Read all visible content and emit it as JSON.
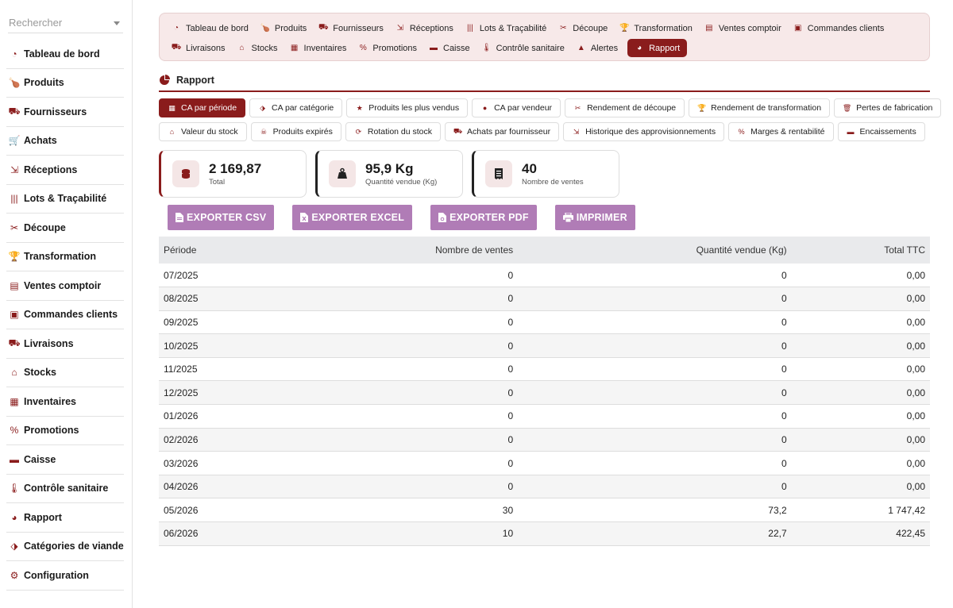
{
  "search": {
    "placeholder": "Rechercher"
  },
  "sidebar": {
    "items": [
      {
        "label": "Tableau de bord",
        "icon": "dashboard-icon"
      },
      {
        "label": "Produits",
        "icon": "drumstick-icon"
      },
      {
        "label": "Fournisseurs",
        "icon": "truck-icon"
      },
      {
        "label": "Achats",
        "icon": "cart-icon"
      },
      {
        "label": "Réceptions",
        "icon": "dolly-icon"
      },
      {
        "label": "Lots & Traçabilité",
        "icon": "barcode-icon"
      },
      {
        "label": "Découpe",
        "icon": "scissors-icon"
      },
      {
        "label": "Transformation",
        "icon": "trophy-icon"
      },
      {
        "label": "Ventes comptoir",
        "icon": "cash-register-icon"
      },
      {
        "label": "Commandes clients",
        "icon": "clipboard-icon"
      },
      {
        "label": "Livraisons",
        "icon": "truck-loading-icon"
      },
      {
        "label": "Stocks",
        "icon": "warehouse-icon"
      },
      {
        "label": "Inventaires",
        "icon": "boxes-icon"
      },
      {
        "label": "Promotions",
        "icon": "percent-icon"
      },
      {
        "label": "Caisse",
        "icon": "money-bill-icon"
      },
      {
        "label": "Contrôle sanitaire",
        "icon": "thermometer-icon"
      },
      {
        "label": "Rapport",
        "icon": "pie-chart-icon"
      },
      {
        "label": "Catégories de viande",
        "icon": "tags-icon"
      },
      {
        "label": "Configuration",
        "icon": "gear-icon"
      }
    ]
  },
  "topnav": {
    "row1": [
      {
        "label": "Tableau de bord",
        "icon": "dashboard-icon"
      },
      {
        "label": "Produits",
        "icon": "drumstick-icon"
      },
      {
        "label": "Fournisseurs",
        "icon": "truck-icon"
      },
      {
        "label": "Réceptions",
        "icon": "dolly-icon"
      },
      {
        "label": "Lots & Traçabilité",
        "icon": "barcode-icon"
      },
      {
        "label": "Découpe",
        "icon": "scissors-icon"
      },
      {
        "label": "Transformation",
        "icon": "trophy-icon"
      },
      {
        "label": "Ventes comptoir",
        "icon": "cash-register-icon"
      },
      {
        "label": "Commandes clients",
        "icon": "clipboard-icon"
      }
    ],
    "row2": [
      {
        "label": "Livraisons",
        "icon": "truck-loading-icon"
      },
      {
        "label": "Stocks",
        "icon": "warehouse-icon"
      },
      {
        "label": "Inventaires",
        "icon": "boxes-icon"
      },
      {
        "label": "Promotions",
        "icon": "percent-icon"
      },
      {
        "label": "Caisse",
        "icon": "money-bill-icon"
      },
      {
        "label": "Contrôle sanitaire",
        "icon": "thermometer-icon"
      },
      {
        "label": "Alertes",
        "icon": "warning-icon"
      },
      {
        "label": "Rapport",
        "icon": "pie-chart-icon",
        "active": true
      }
    ]
  },
  "page": {
    "title": "Rapport"
  },
  "subtabs": {
    "row1": [
      {
        "label": "CA par période",
        "icon": "calendar-icon",
        "active": true
      },
      {
        "label": "CA par catégorie",
        "icon": "tags-icon"
      },
      {
        "label": "Produits les plus vendus",
        "icon": "star-icon"
      },
      {
        "label": "CA par vendeur",
        "icon": "user-icon"
      },
      {
        "label": "Rendement de découpe",
        "icon": "scissors-icon"
      },
      {
        "label": "Rendement de transformation",
        "icon": "trophy-icon"
      },
      {
        "label": "Pertes de fabrication",
        "icon": "trash-icon"
      }
    ],
    "row2": [
      {
        "label": "Valeur du stock",
        "icon": "warehouse-icon"
      },
      {
        "label": "Produits expirés",
        "icon": "skull-icon"
      },
      {
        "label": "Rotation du stock",
        "icon": "sync-icon"
      },
      {
        "label": "Achats par fournisseur",
        "icon": "truck-icon"
      },
      {
        "label": "Historique des approvisionnements",
        "icon": "dolly-icon"
      },
      {
        "label": "Marges & rentabilité",
        "icon": "percent-icon"
      },
      {
        "label": "Encaissements",
        "icon": "money-bill-icon"
      }
    ]
  },
  "cards": [
    {
      "value": "2 169,87",
      "label": "Total",
      "icon": "coins-icon"
    },
    {
      "value": "95,9 Kg",
      "label": "Quantité vendue (Kg)",
      "icon": "weight-icon"
    },
    {
      "value": "40",
      "label": "Nombre de ventes",
      "icon": "receipt-icon"
    }
  ],
  "actions": [
    {
      "label": "EXPORTER CSV",
      "icon": "file-csv-icon"
    },
    {
      "label": "EXPORTER EXCEL",
      "icon": "file-excel-icon"
    },
    {
      "label": "EXPORTER PDF",
      "icon": "file-pdf-icon"
    },
    {
      "label": "IMPRIMER",
      "icon": "print-icon"
    }
  ],
  "table": {
    "headers": [
      "Période",
      "Nombre de ventes",
      "Quantité vendue (Kg)",
      "Total TTC"
    ],
    "rows": [
      [
        "07/2025",
        "0",
        "0",
        "0,00"
      ],
      [
        "08/2025",
        "0",
        "0",
        "0,00"
      ],
      [
        "09/2025",
        "0",
        "0",
        "0,00"
      ],
      [
        "10/2025",
        "0",
        "0",
        "0,00"
      ],
      [
        "11/2025",
        "0",
        "0",
        "0,00"
      ],
      [
        "12/2025",
        "0",
        "0",
        "0,00"
      ],
      [
        "01/2026",
        "0",
        "0",
        "0,00"
      ],
      [
        "02/2026",
        "0",
        "0",
        "0,00"
      ],
      [
        "03/2026",
        "0",
        "0",
        "0,00"
      ],
      [
        "04/2026",
        "0",
        "0",
        "0,00"
      ],
      [
        "05/2026",
        "30",
        "73,2",
        "1 747,42"
      ],
      [
        "06/2026",
        "10",
        "22,7",
        "422,45"
      ]
    ]
  },
  "colors": {
    "accent": "#8a1c1c",
    "button": "#b07cb6",
    "nav_bg": "#f7e9e9"
  }
}
